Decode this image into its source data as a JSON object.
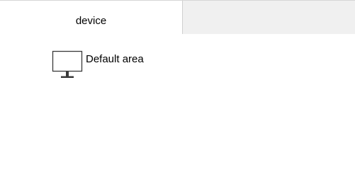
{
  "header": {
    "columns": [
      {
        "label": "device"
      }
    ]
  },
  "tree": {
    "items": [
      {
        "label": "Default area",
        "icon": "monitor-icon"
      }
    ]
  }
}
